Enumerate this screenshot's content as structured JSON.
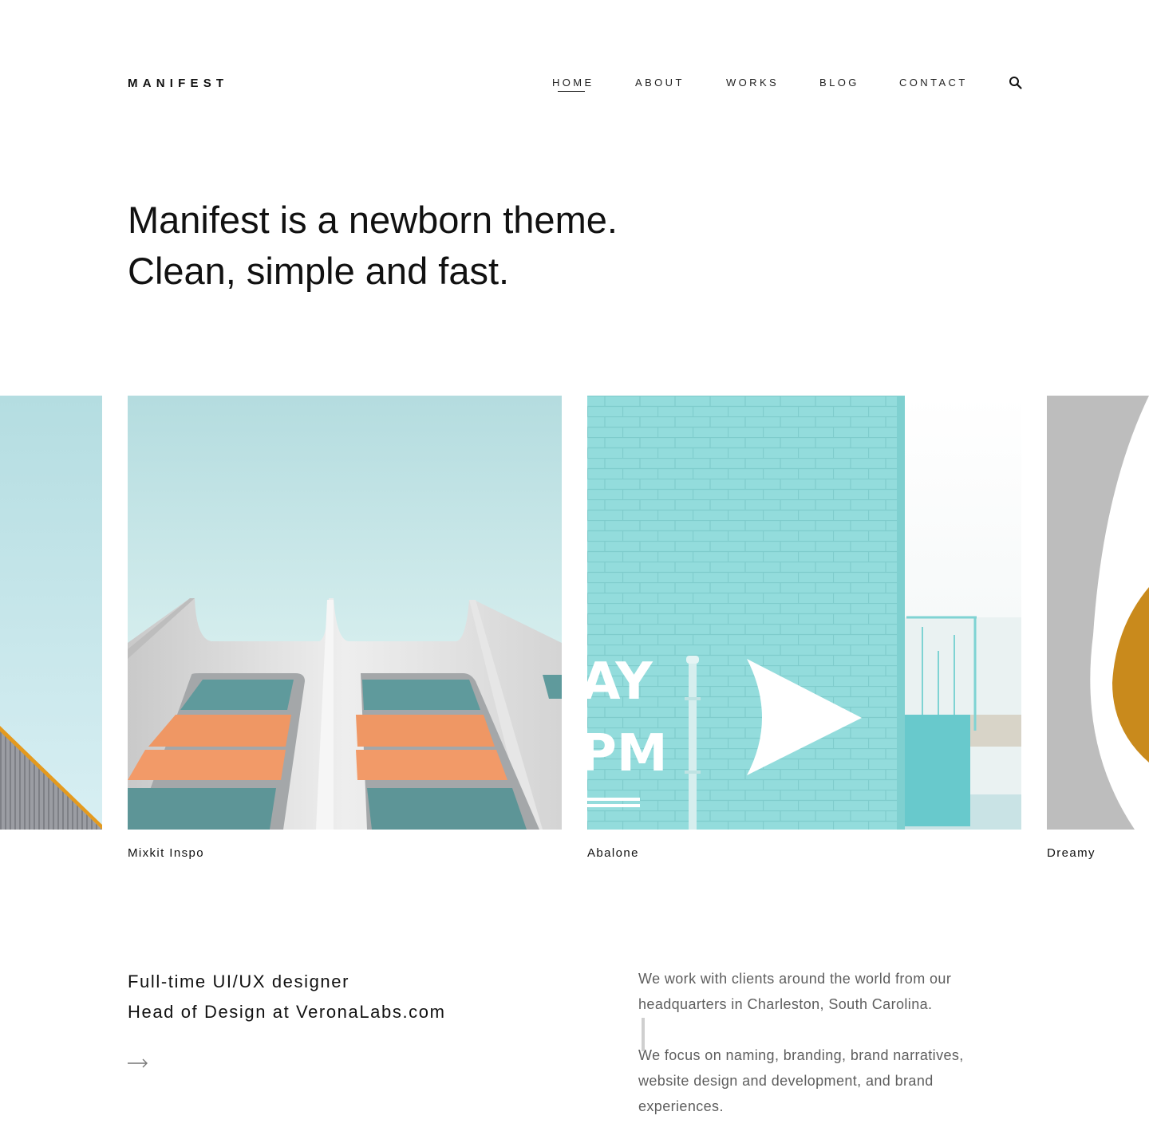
{
  "header": {
    "logo": "MANIFEST",
    "nav": [
      {
        "label": "HOME",
        "active": true
      },
      {
        "label": "ABOUT",
        "active": false
      },
      {
        "label": "WORKS",
        "active": false
      },
      {
        "label": "BLOG",
        "active": false
      },
      {
        "label": "CONTACT",
        "active": false
      }
    ],
    "search_icon": "search-icon"
  },
  "hero": {
    "line1": "Manifest is a newborn theme.",
    "line2": "Clean, simple and fast."
  },
  "gallery": {
    "items": [
      {
        "caption": "Mixkit Inspo"
      },
      {
        "caption": "Abalone"
      },
      {
        "caption": "Dreamy"
      }
    ]
  },
  "bio": {
    "line1": "Full-time UI/UX designer",
    "line2": "Head of Design at VeronaLabs.com",
    "arrow_icon": "arrow-right-icon"
  },
  "about": {
    "paragraph1": "We work with clients around the world from our headquarters in Charleston, South Carolina.",
    "paragraph2": "We focus on naming, branding, brand narratives, website design and development, and brand experiences."
  },
  "colors": {
    "text": "#111111",
    "muted": "#5e5e5e",
    "sky": "#b6dde0",
    "brick": "#8ed8d9",
    "orange": "#f29a68"
  }
}
